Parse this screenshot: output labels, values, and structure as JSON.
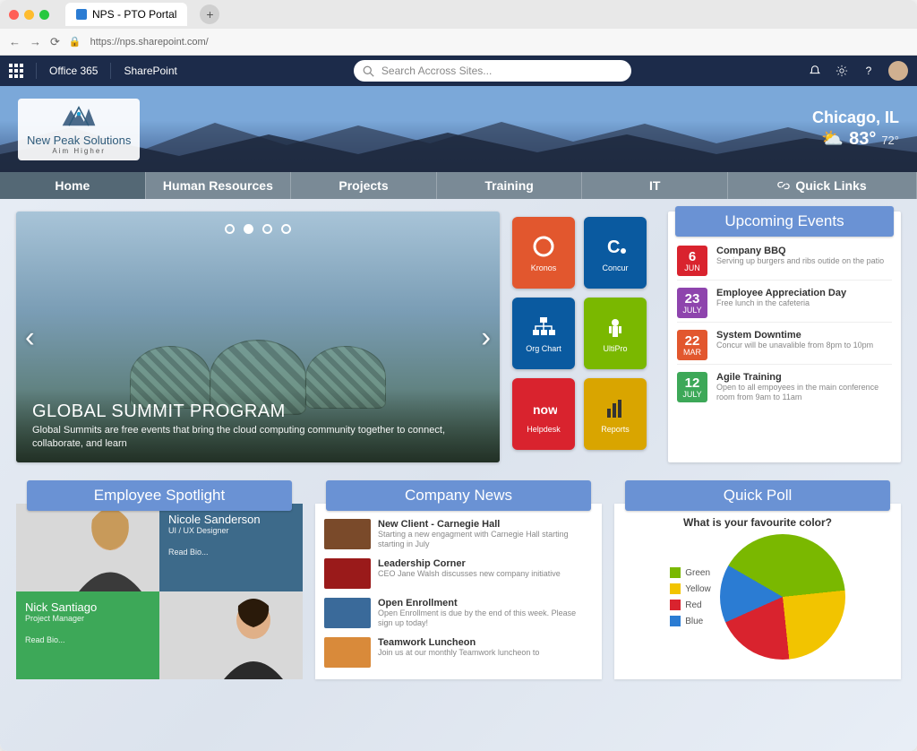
{
  "browser": {
    "tab_title": "NPS - PTO Portal",
    "url": "https://nps.sharepoint.com/"
  },
  "suite": {
    "office": "Office 365",
    "app": "SharePoint",
    "search_placeholder": "Search Accross Sites..."
  },
  "logo": {
    "line1": "New Peak Solutions",
    "line2": "Aim Higher"
  },
  "weather": {
    "location": "Chicago, IL",
    "hi": "83°",
    "lo": "72°"
  },
  "nav": [
    "Home",
    "Human Resources",
    "Projects",
    "Training",
    "IT"
  ],
  "nav_quick": "Quick Links",
  "hero": {
    "title": "GLOBAL SUMMIT PROGRAM",
    "subtitle": "Global Summits are free events that bring the cloud computing community together to connect, collaborate, and learn"
  },
  "apps": [
    {
      "label": "Kronos",
      "color": "#e2572e"
    },
    {
      "label": "Concur",
      "color": "#0a5aa0"
    },
    {
      "label": "Org Chart",
      "color": "#0a5aa0"
    },
    {
      "label": "UltiPro",
      "color": "#7ab800"
    },
    {
      "label": "Helpdesk",
      "color": "#d9232e"
    },
    {
      "label": "Reports",
      "color": "#d9a500"
    }
  ],
  "events_hdr": "Upcoming Events",
  "events": [
    {
      "day": "6",
      "mon": "JUN",
      "color": "#d9232e",
      "title": "Company BBQ",
      "desc": "Serving up burgers and ribs outide on the patio"
    },
    {
      "day": "23",
      "mon": "JULY",
      "color": "#8e44ad",
      "title": "Employee Appreciation Day",
      "desc": "Free lunch in the cafeteria"
    },
    {
      "day": "22",
      "mon": "MAR",
      "color": "#e2572e",
      "title": "System Downtime",
      "desc": "Concur will be unavalible from 8pm to 10pm"
    },
    {
      "day": "12",
      "mon": "JULY",
      "color": "#3da858",
      "title": "Agile Training",
      "desc": "Open to all empoyees in the main conference room from 9am to 11am"
    }
  ],
  "spotlight_hdr": "Employee Spotlight",
  "spotlight": {
    "p1": {
      "name": "Nicole Sanderson",
      "role": "UI / UX Designer",
      "bio": "Read Bio..."
    },
    "p2": {
      "name": "Nick Santiago",
      "role": "Project Manager",
      "bio": "Read Bio..."
    }
  },
  "news_hdr": "Company News",
  "news": [
    {
      "title": "New Client - Carnegie Hall",
      "desc": "Starting a new engagment with Carnegie Hall starting starting in July",
      "thumb": "#7a4a2a"
    },
    {
      "title": "Leadership Corner",
      "desc": "CEO Jane Walsh discusses new company initiative",
      "thumb": "#9a1a1a"
    },
    {
      "title": "Open Enrollment",
      "desc": "Open Enrollment is due by the end of this week. Please sign up today!",
      "thumb": "#3a6a9a"
    },
    {
      "title": "Teamwork Luncheon",
      "desc": "Join us at our monthly Teamwork luncheon to",
      "thumb": "#d98a3a"
    }
  ],
  "poll_hdr": "Quick Poll",
  "poll_q": "What is your favourite color?",
  "chart_data": {
    "type": "pie",
    "title": "What is your favourite color?",
    "categories": [
      "Green",
      "Yellow",
      "Red",
      "Blue"
    ],
    "values": [
      40,
      25,
      20,
      15
    ],
    "colors": [
      "#7ab800",
      "#f2c400",
      "#d9232e",
      "#2b7cd3"
    ]
  }
}
